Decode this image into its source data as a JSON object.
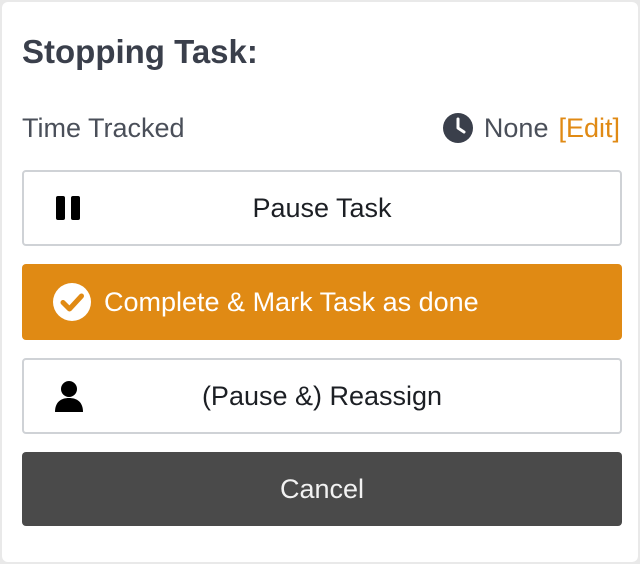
{
  "dialog": {
    "title": "Stopping Task:",
    "time_tracked": {
      "label": "Time Tracked",
      "value": "None",
      "edit_label": "[Edit]"
    },
    "actions": {
      "pause_label": "Pause Task",
      "complete_label": "Complete & Mark Task as done",
      "reassign_label": "(Pause &) Reassign",
      "cancel_label": "Cancel"
    },
    "icons": {
      "time": "clock-icon",
      "pause": "pause-icon",
      "complete": "check-circle-icon",
      "reassign": "user-icon"
    },
    "colors": {
      "accent": "#e08a14",
      "cancel_bg": "#4a4a4a",
      "title_text": "#3a3f4b"
    }
  }
}
